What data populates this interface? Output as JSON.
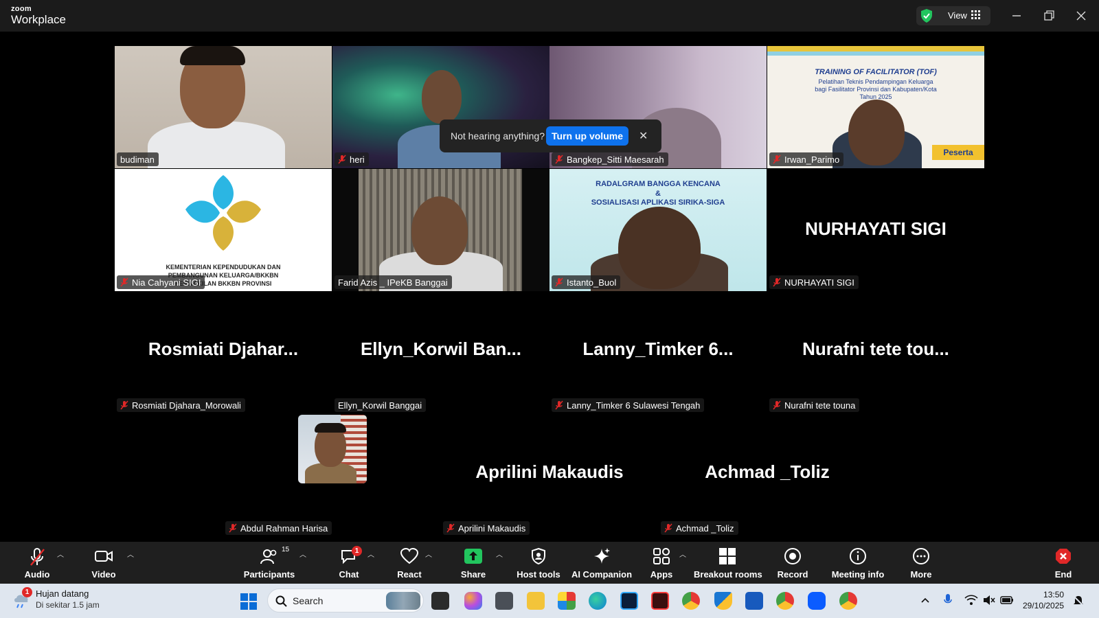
{
  "window": {
    "brand_top": "zoom",
    "brand_bottom": "Workplace",
    "view_label": "View"
  },
  "toast": {
    "message": "Not hearing anything?",
    "button": "Turn up volume",
    "close": "✕"
  },
  "participants": [
    {
      "name": "budiman",
      "muted": false
    },
    {
      "name": "heri",
      "muted": true
    },
    {
      "name": "Bangkep_Sitti Maesarah",
      "muted": true
    },
    {
      "name": "Irwan_Parimo",
      "muted": true
    },
    {
      "name": "Nia Cahyani SIGI",
      "muted": true
    },
    {
      "name": "Farid Azis _ IPeKB Banggai",
      "muted": false,
      "speaking": true
    },
    {
      "name": "Istanto_Buol",
      "muted": true
    },
    {
      "name": "NURHAYATI SIGI",
      "muted": true,
      "display": "NURHAYATI SIGI"
    },
    {
      "name": "Rosmiati Djahara_Morowali",
      "muted": true,
      "display": "Rosmiati  Djahar..."
    },
    {
      "name": "Ellyn_Korwil Banggai",
      "muted": false,
      "display": "Ellyn_Korwil  Ban..."
    },
    {
      "name": "Lanny_Timker 6 Sulawesi Tengah",
      "muted": true,
      "display": "Lanny_Timker  6..."
    },
    {
      "name": "Nurafni tete touna",
      "muted": true,
      "display": "Nurafni  tete  tou..."
    },
    {
      "name": "Abdul Rahman Harisa",
      "muted": true
    },
    {
      "name": "Aprilini Makaudis",
      "muted": true,
      "display": "Aprilini Makaudis"
    },
    {
      "name": "Achmad _Toliz",
      "muted": true,
      "display": "Achmad _Toliz"
    }
  ],
  "tile_text": {
    "tof_title": "TRAINING OF FACILITATOR (TOF)",
    "tof_sub1": "Pelatihan Teknis Pendampingan Keluarga",
    "tof_sub2": "bagi Fasilitator Provinsi dan Kabupaten/Kota",
    "tof_year": "Tahun 2025",
    "tof_tag": "Peserta",
    "kem_line1": "KEMENTERIAN KEPENDUDUKAN DAN",
    "kem_line2": "PEMBANGUNAN KELUARGA/BKKBN",
    "kem_line3": "PERWAKILAN BKKBN PROVINSI",
    "rad_line1": "RADALGRAM BANGGA KENCANA",
    "rad_amp": "&",
    "rad_line2": "SOSIALISASI APLIKASI SIRIKA-SIGA"
  },
  "toolbar": {
    "audio": "Audio",
    "video": "Video",
    "participants": "Participants",
    "participants_count": "15",
    "chat": "Chat",
    "chat_badge": "1",
    "react": "React",
    "share": "Share",
    "host_tools": "Host tools",
    "ai_companion": "AI Companion",
    "apps": "Apps",
    "breakout": "Breakout rooms",
    "record": "Record",
    "meeting_info": "Meeting info",
    "more": "More",
    "end": "End"
  },
  "taskbar": {
    "weather_title": "Hujan datang",
    "weather_sub": "Di sekitar 1.5 jam",
    "weather_badge": "1",
    "search": "Search",
    "time": "13:50",
    "date": "29/10/2025"
  },
  "colors": {
    "accent": "#0e72ed",
    "speaking": "#22c55e",
    "muted_red": "#e02828",
    "share_green": "#22c55e"
  }
}
